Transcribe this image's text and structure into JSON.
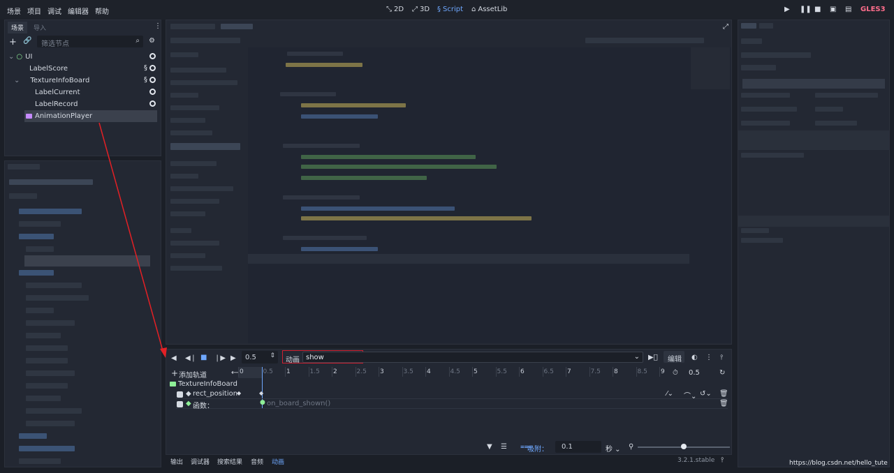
{
  "menu": [
    "场景",
    "项目",
    "调试",
    "编辑器",
    "帮助"
  ],
  "modes": [
    {
      "label": "2D",
      "icon": "2d-icon"
    },
    {
      "label": "3D",
      "icon": "3d-icon"
    },
    {
      "label": "Script",
      "icon": "script-icon",
      "active": true
    },
    {
      "label": "AssetLib",
      "icon": "assetlib-icon"
    }
  ],
  "renderer": "GLES3",
  "scene_dock": {
    "tabs": [
      "场景",
      "导入"
    ],
    "filter_placeholder": "筛选节点",
    "nodes": [
      {
        "name": "UI",
        "type": "control",
        "color": "#8eef97"
      },
      {
        "name": "LabelScore",
        "type": "label",
        "color": "#8eef97",
        "script": true
      },
      {
        "name": "TextureInfoBoard",
        "type": "texture",
        "color": "#8eef97",
        "script": true
      },
      {
        "name": "LabelCurrent",
        "type": "label",
        "color": "#8eef97"
      },
      {
        "name": "LabelRecord",
        "type": "label",
        "color": "#8eef97"
      },
      {
        "name": "AnimationPlayer",
        "type": "animation",
        "color": "#c58aff",
        "selected": true
      }
    ]
  },
  "animation": {
    "time_value": "0.5",
    "anim_label": "动画",
    "anim_name": "show",
    "edit_label": "编辑",
    "add_track": "添加轨道",
    "node_name": "TextureInfoBoard",
    "tracks": [
      {
        "label": "rect_position",
        "kind": "property"
      },
      {
        "label": "函数：",
        "kind": "method",
        "key_label": "on_board_shown()"
      }
    ],
    "timeline_end": "0.5",
    "ticks": [
      "0",
      "0.5",
      "1",
      "1.5",
      "2",
      "2.5",
      "3",
      "3.5",
      "4",
      "4.5",
      "5",
      "5.5",
      "6",
      "6.5",
      "7",
      "7.5",
      "8",
      "8.5",
      "9"
    ],
    "snap_label": "吸附：",
    "snap_value": "0.1",
    "snap_unit": "秒"
  },
  "bottom_tabs": [
    "输出",
    "调试器",
    "搜索结果",
    "音频",
    "动画"
  ],
  "version": "3.2.1.stable",
  "watermark": "https://blog.csdn.net/hello_tute"
}
